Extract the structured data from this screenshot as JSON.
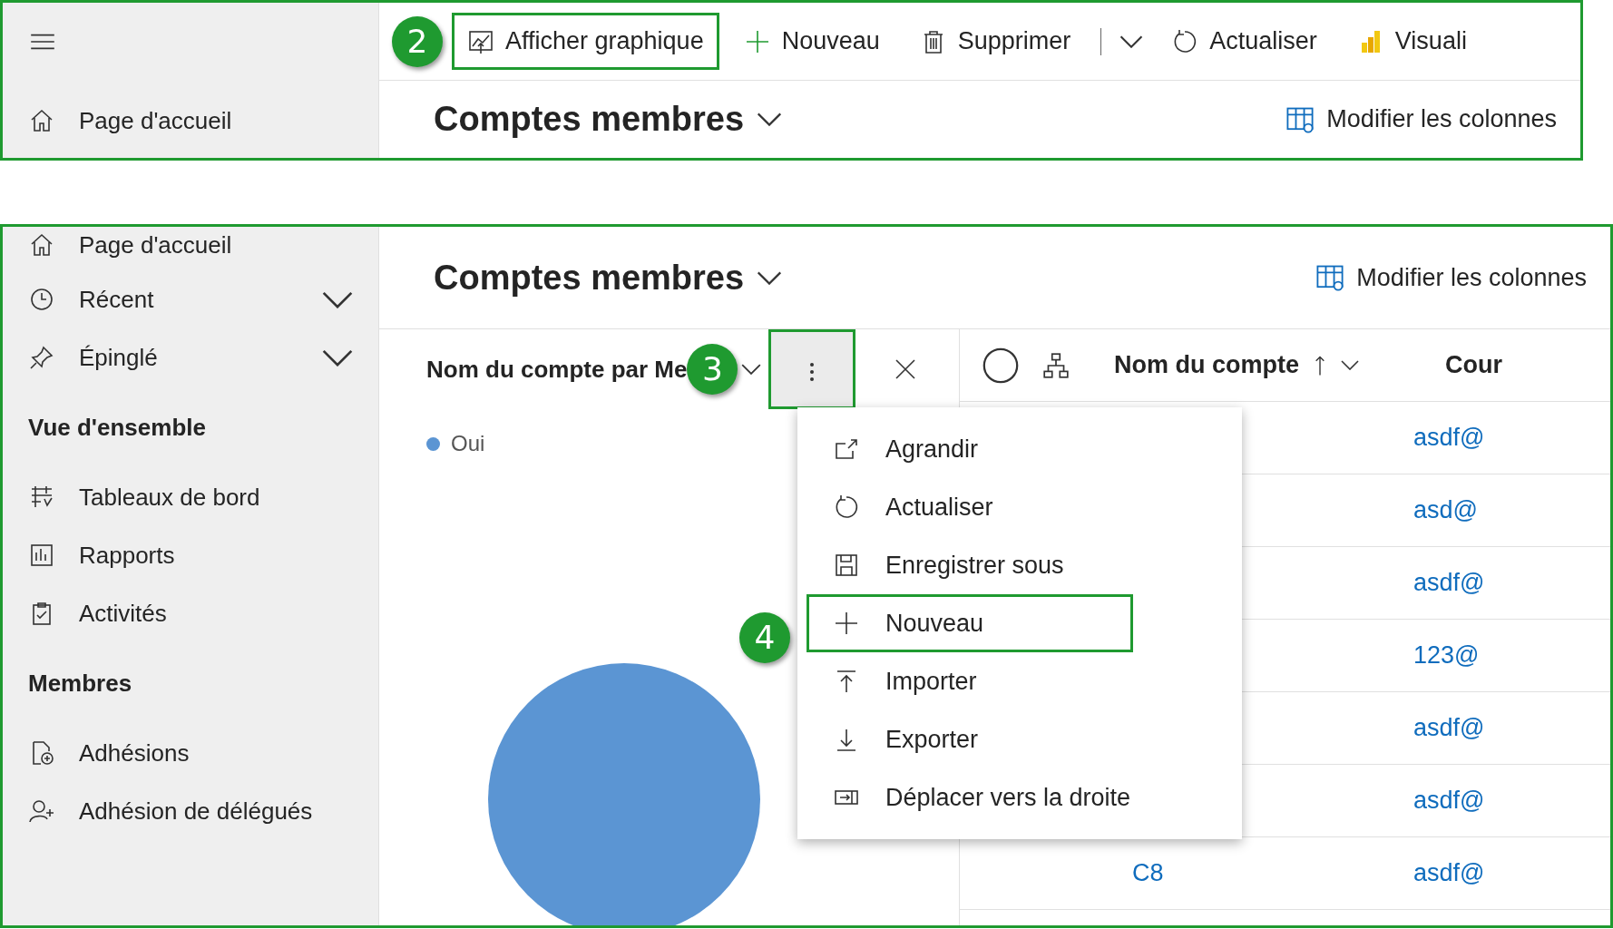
{
  "top_panel": {
    "callout": "2",
    "sidebar": {
      "items": [
        {
          "label": "Page d'accueil"
        }
      ]
    },
    "toolbar": [
      {
        "label": "Afficher graphique",
        "kind": "button",
        "highlighted": true
      },
      {
        "label": "Nouveau",
        "kind": "button",
        "highlighted": false
      },
      {
        "label": "Supprimer",
        "kind": "split",
        "highlighted": false
      },
      {
        "label": "Actualiser",
        "kind": "button",
        "highlighted": false
      },
      {
        "label": "Visuali",
        "kind": "button",
        "highlighted": false
      }
    ],
    "view_title": "Comptes membres",
    "edit_columns": "Modifier les colonnes"
  },
  "bottom_panel": {
    "sidebar": {
      "items": [
        {
          "kind": "item",
          "label": "Page d'accueil"
        },
        {
          "kind": "group",
          "label": "Récent",
          "expanded": false
        },
        {
          "kind": "group",
          "label": "Épinglé",
          "expanded": false
        },
        {
          "kind": "section",
          "label": "Vue d'ensemble"
        },
        {
          "kind": "item",
          "label": "Tableaux de bord"
        },
        {
          "kind": "item",
          "label": "Rapports"
        },
        {
          "kind": "item",
          "label": "Activités"
        },
        {
          "kind": "section",
          "label": "Membres"
        },
        {
          "kind": "item",
          "label": "Adhésions"
        },
        {
          "kind": "item",
          "label": "Adhésion de délégués"
        }
      ]
    },
    "view_title": "Comptes membres",
    "edit_columns": "Modifier les colonnes",
    "chart": {
      "title": "Nom du compte par Me",
      "callout": "3",
      "more_button_highlighted": true,
      "legend": [
        {
          "label": "Oui",
          "color": "#5b95d3"
        }
      ]
    },
    "menu": {
      "callout": "4",
      "items": [
        {
          "label": "Agrandir",
          "highlighted": false
        },
        {
          "label": "Actualiser",
          "highlighted": false
        },
        {
          "label": "Enregistrer sous",
          "highlighted": false
        },
        {
          "label": "Nouveau",
          "highlighted": true
        },
        {
          "label": "Importer",
          "highlighted": false
        },
        {
          "label": "Exporter",
          "highlighted": false
        },
        {
          "label": "Déplacer vers la droite",
          "highlighted": false
        }
      ]
    },
    "grid": {
      "columns": [
        "Nom du compte",
        "Cour"
      ],
      "rows": [
        {
          "email": "asdf@"
        },
        {
          "email": "asd@"
        },
        {
          "email": "asdf@"
        },
        {
          "email": "123@"
        },
        {
          "email": "asdf@"
        },
        {
          "email": "asdf@"
        },
        {
          "name": "C8",
          "email": "asdf@"
        }
      ]
    }
  }
}
